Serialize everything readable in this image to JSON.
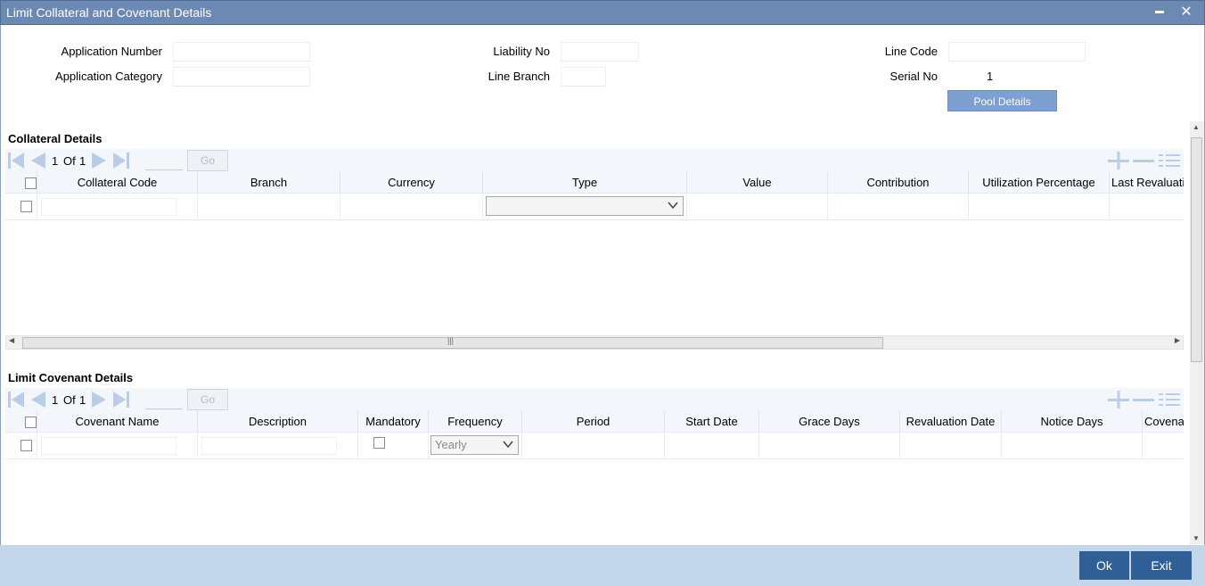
{
  "window": {
    "title": "Limit Collateral and Covenant Details",
    "minimize_glyph": "▬",
    "close_glyph": "✕"
  },
  "header": {
    "application_number_label": "Application Number",
    "application_category_label": "Application Category",
    "liability_no_label": "Liability No",
    "line_branch_label": "Line Branch",
    "line_code_label": "Line Code",
    "serial_no_label": "Serial No",
    "serial_no_value": "1",
    "pool_details_label": "Pool Details"
  },
  "collateral": {
    "title": "Collateral Details",
    "pagination": {
      "current": "1",
      "of": "Of",
      "total": "1",
      "go_label": "Go"
    },
    "columns": [
      "Collateral Code",
      "Branch",
      "Currency",
      "Type",
      "Value",
      "Contribution",
      "Utilization Percentage",
      "Last Revaluati"
    ],
    "type_value": ""
  },
  "covenant": {
    "title": "Limit Covenant Details",
    "pagination": {
      "current": "1",
      "of": "Of",
      "total": "1",
      "go_label": "Go"
    },
    "columns": [
      "Covenant Name",
      "Description",
      "Mandatory",
      "Frequency",
      "Period",
      "Start Date",
      "Grace Days",
      "Revaluation Date",
      "Notice Days",
      "Covena"
    ],
    "frequency_value": "Yearly"
  },
  "scrollbar": {
    "grip_glyph": "|||"
  },
  "footer": {
    "ok_label": "Ok",
    "exit_label": "Exit"
  },
  "colors": {
    "titlebar": "#6b89b3",
    "button": "#2f5f96",
    "footer": "#c4d7ea",
    "pool_button": "#7d9fd1"
  },
  "icons": [
    "first-page-icon",
    "prev-page-icon",
    "next-page-icon",
    "last-page-icon",
    "add-row-icon",
    "delete-row-icon",
    "single-view-icon",
    "chevron-down-icon",
    "minimize-icon",
    "close-icon"
  ]
}
